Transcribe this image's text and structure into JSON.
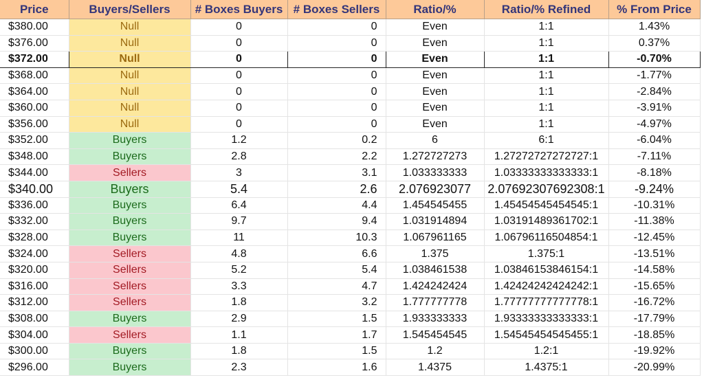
{
  "colors": {
    "header_bg": "#fdc999",
    "header_text": "#33357a",
    "null_bg": "#fde89d",
    "null_text": "#9b6a10",
    "buyers_bg": "#c7eece",
    "buyers_text": "#1c6b1c",
    "sellers_bg": "#fbc7cd",
    "sellers_text": "#a21a23"
  },
  "headers": [
    "Price",
    "Buyers/Sellers",
    "# Boxes Buyers",
    "# Boxes Sellers",
    "Ratio/%",
    "Ratio/% Refined",
    "% From Price"
  ],
  "rows": [
    {
      "price": "$380.00",
      "side": "Null",
      "boxes_buyers": "0",
      "boxes_sellers": "0",
      "ratio": "Even",
      "ratio_refined": "1:1",
      "pct_from_price": "1.43%"
    },
    {
      "price": "$376.00",
      "side": "Null",
      "boxes_buyers": "0",
      "boxes_sellers": "0",
      "ratio": "Even",
      "ratio_refined": "1:1",
      "pct_from_price": "0.37%"
    },
    {
      "price": "$372.00",
      "side": "Null",
      "boxes_buyers": "0",
      "boxes_sellers": "0",
      "ratio": "Even",
      "ratio_refined": "1:1",
      "pct_from_price": "-0.70%",
      "current": true
    },
    {
      "price": "$368.00",
      "side": "Null",
      "boxes_buyers": "0",
      "boxes_sellers": "0",
      "ratio": "Even",
      "ratio_refined": "1:1",
      "pct_from_price": "-1.77%"
    },
    {
      "price": "$364.00",
      "side": "Null",
      "boxes_buyers": "0",
      "boxes_sellers": "0",
      "ratio": "Even",
      "ratio_refined": "1:1",
      "pct_from_price": "-2.84%"
    },
    {
      "price": "$360.00",
      "side": "Null",
      "boxes_buyers": "0",
      "boxes_sellers": "0",
      "ratio": "Even",
      "ratio_refined": "1:1",
      "pct_from_price": "-3.91%"
    },
    {
      "price": "$356.00",
      "side": "Null",
      "boxes_buyers": "0",
      "boxes_sellers": "0",
      "ratio": "Even",
      "ratio_refined": "1:1",
      "pct_from_price": "-4.97%"
    },
    {
      "price": "$352.00",
      "side": "Buyers",
      "boxes_buyers": "1.2",
      "boxes_sellers": "0.2",
      "ratio": "6",
      "ratio_refined": "6:1",
      "pct_from_price": "-6.04%"
    },
    {
      "price": "$348.00",
      "side": "Buyers",
      "boxes_buyers": "2.8",
      "boxes_sellers": "2.2",
      "ratio": "1.272727273",
      "ratio_refined": "1.27272727272727:1",
      "pct_from_price": "-7.11%"
    },
    {
      "price": "$344.00",
      "side": "Sellers",
      "boxes_buyers": "3",
      "boxes_sellers": "3.1",
      "ratio": "1.033333333",
      "ratio_refined": "1.03333333333333:1",
      "pct_from_price": "-8.18%"
    },
    {
      "price": "$340.00",
      "side": "Buyers",
      "boxes_buyers": "5.4",
      "boxes_sellers": "2.6",
      "ratio": "2.076923077",
      "ratio_refined": "2.07692307692308:1",
      "pct_from_price": "-9.24%",
      "large": true
    },
    {
      "price": "$336.00",
      "side": "Buyers",
      "boxes_buyers": "6.4",
      "boxes_sellers": "4.4",
      "ratio": "1.454545455",
      "ratio_refined": "1.45454545454545:1",
      "pct_from_price": "-10.31%"
    },
    {
      "price": "$332.00",
      "side": "Buyers",
      "boxes_buyers": "9.7",
      "boxes_sellers": "9.4",
      "ratio": "1.031914894",
      "ratio_refined": "1.03191489361702:1",
      "pct_from_price": "-11.38%"
    },
    {
      "price": "$328.00",
      "side": "Buyers",
      "boxes_buyers": "11",
      "boxes_sellers": "10.3",
      "ratio": "1.067961165",
      "ratio_refined": "1.06796116504854:1",
      "pct_from_price": "-12.45%"
    },
    {
      "price": "$324.00",
      "side": "Sellers",
      "boxes_buyers": "4.8",
      "boxes_sellers": "6.6",
      "ratio": "1.375",
      "ratio_refined": "1.375:1",
      "pct_from_price": "-13.51%"
    },
    {
      "price": "$320.00",
      "side": "Sellers",
      "boxes_buyers": "5.2",
      "boxes_sellers": "5.4",
      "ratio": "1.038461538",
      "ratio_refined": "1.03846153846154:1",
      "pct_from_price": "-14.58%"
    },
    {
      "price": "$316.00",
      "side": "Sellers",
      "boxes_buyers": "3.3",
      "boxes_sellers": "4.7",
      "ratio": "1.424242424",
      "ratio_refined": "1.42424242424242:1",
      "pct_from_price": "-15.65%"
    },
    {
      "price": "$312.00",
      "side": "Sellers",
      "boxes_buyers": "1.8",
      "boxes_sellers": "3.2",
      "ratio": "1.777777778",
      "ratio_refined": "1.77777777777778:1",
      "pct_from_price": "-16.72%"
    },
    {
      "price": "$308.00",
      "side": "Buyers",
      "boxes_buyers": "2.9",
      "boxes_sellers": "1.5",
      "ratio": "1.933333333",
      "ratio_refined": "1.93333333333333:1",
      "pct_from_price": "-17.79%"
    },
    {
      "price": "$304.00",
      "side": "Sellers",
      "boxes_buyers": "1.1",
      "boxes_sellers": "1.7",
      "ratio": "1.545454545",
      "ratio_refined": "1.54545454545455:1",
      "pct_from_price": "-18.85%"
    },
    {
      "price": "$300.00",
      "side": "Buyers",
      "boxes_buyers": "1.8",
      "boxes_sellers": "1.5",
      "ratio": "1.2",
      "ratio_refined": "1.2:1",
      "pct_from_price": "-19.92%"
    },
    {
      "price": "$296.00",
      "side": "Buyers",
      "boxes_buyers": "2.3",
      "boxes_sellers": "1.6",
      "ratio": "1.4375",
      "ratio_refined": "1.4375:1",
      "pct_from_price": "-20.99%"
    }
  ]
}
